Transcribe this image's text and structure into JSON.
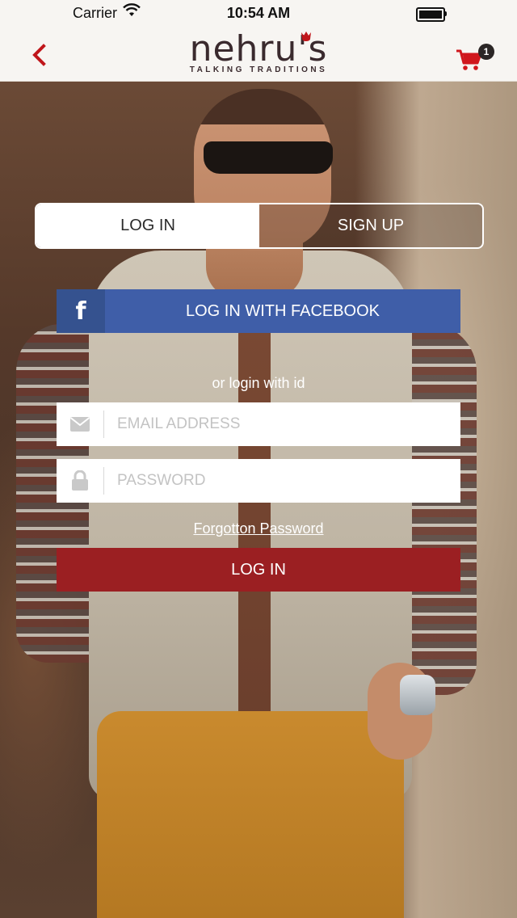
{
  "status_bar": {
    "carrier": "Carrier",
    "time": "10:54 AM"
  },
  "header": {
    "logo_text": "nehru's",
    "tagline": "TALKING TRADITIONS",
    "cart_count": "1",
    "icons": {
      "back": "chevron-left-icon",
      "cart": "shopping-cart-icon"
    }
  },
  "auth_tabs": {
    "login": "LOG IN",
    "signup": "SIGN UP",
    "active": "login"
  },
  "facebook": {
    "icon": "f",
    "label": "LOG IN WITH FACEBOOK"
  },
  "divider_text": "or login with id",
  "form": {
    "email_placeholder": "EMAIL ADDRESS",
    "password_placeholder": "PASSWORD",
    "forgot_label": "Forgotton Password",
    "submit_label": "LOG IN"
  },
  "colors": {
    "brand_red": "#9b1f22",
    "facebook_blue": "#3f5ea8",
    "facebook_icon_bg": "#35528f",
    "header_bg": "#f7f5f2"
  }
}
